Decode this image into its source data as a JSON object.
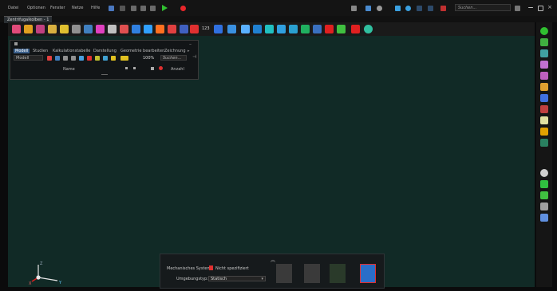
{
  "menu": {
    "items": [
      "Datei",
      "Optionen",
      "Fenster",
      "Netze",
      "Hilfe"
    ]
  },
  "search": {
    "placeholder": "Suchen..."
  },
  "tabs": [
    {
      "label": "Zentrifugalkolben - 1"
    }
  ],
  "toolbar": {
    "count_label": "123"
  },
  "tree_panel": {
    "tabs": [
      "Modell",
      "Studien",
      "Kalkulationstabelle",
      "Darstellung",
      "Geometrie bearbeiten",
      "Zeichnung"
    ],
    "view_select": "Modell",
    "zoom": "100%",
    "search_placeholder": "Suchen...",
    "columns": {
      "name": "Name",
      "count": "Anzahl"
    }
  },
  "mech_panel": {
    "system_label": "Mechanisches System:",
    "system_value": "Nicht spezifiziert",
    "env_label": "Umgebungstyp:",
    "env_value": "Statisch"
  },
  "axes": {
    "z": "Z",
    "x": "X",
    "y": "Y"
  },
  "colors": {
    "viewport_bg": "#112a26",
    "accent_tab": "#3b5f8a",
    "record_red": "#e8262a",
    "play_green": "#30c030"
  }
}
